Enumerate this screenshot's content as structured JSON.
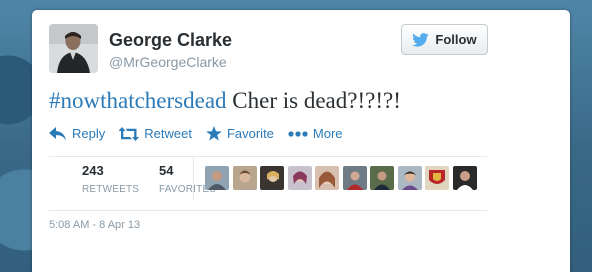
{
  "tweet": {
    "display_name": "George Clarke",
    "screen_name": "@MrGeorgeClarke",
    "hashtag": "#nowthatchersdead",
    "text": " Cher is dead?!?!?!",
    "timestamp": "5:08 AM - 8 Apr 13"
  },
  "follow": {
    "label": "Follow"
  },
  "actions": {
    "reply": "Reply",
    "retweet": "Retweet",
    "favorite": "Favorite",
    "more": "More"
  },
  "stats": {
    "retweets_count": "243",
    "retweets_label": "RETWEETS",
    "favorites_count": "54",
    "favorites_label": "FAVORITES"
  },
  "colors": {
    "link": "#2b7bb9",
    "text": "#292f33",
    "muted": "#8899a6",
    "twitter_bird": "#55acee"
  },
  "icons": [
    "twitter-bird-icon",
    "reply-icon",
    "retweet-icon",
    "star-icon",
    "more-dots-icon"
  ]
}
